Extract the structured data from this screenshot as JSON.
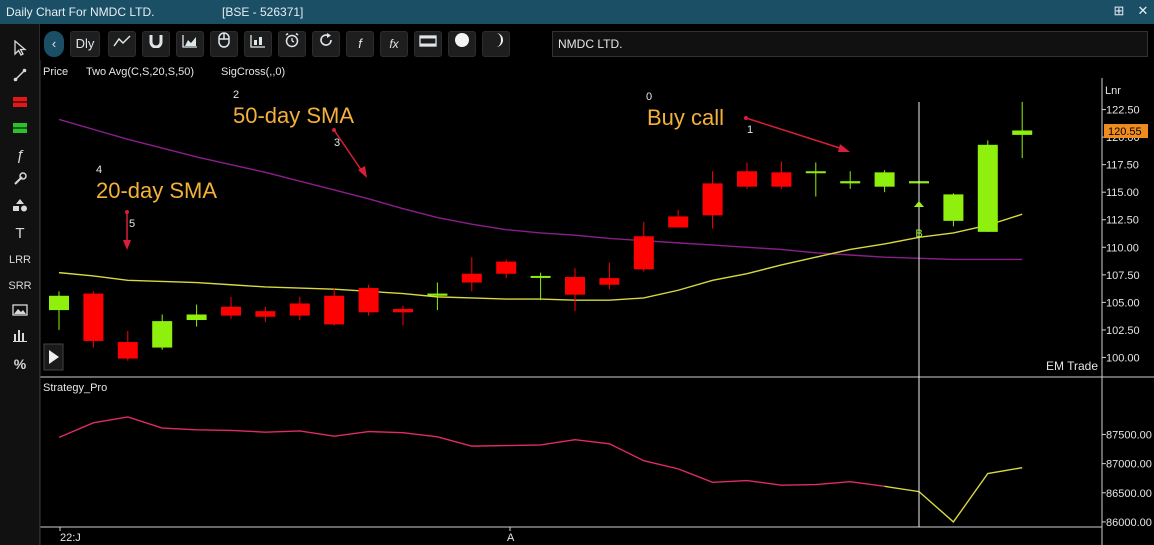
{
  "window": {
    "title": "Daily Chart For NMDC LTD.",
    "exchange": "[BSE - 526371]",
    "pin_icon": "pin-icon",
    "close_icon": "close-icon"
  },
  "toolbar": {
    "period": "Dly",
    "symbol_value": "NMDC LTD.",
    "fx_label": "fx",
    "f_label": "f",
    "buttons": [
      "back-icon",
      "line-icon",
      "magnet-icon",
      "area-icon",
      "mouse-icon",
      "bars-icon",
      "alarm-icon",
      "refresh-icon",
      "f-icon",
      "fx-icon",
      "film-icon",
      "circle-icon",
      "moon-icon"
    ]
  },
  "sidebar": {
    "items": [
      {
        "icon": "cursor-icon",
        "label": ""
      },
      {
        "icon": "trendline-icon",
        "label": ""
      },
      {
        "icon": "red-block-icon",
        "label": ""
      },
      {
        "icon": "green-block-icon",
        "label": ""
      },
      {
        "icon": "function-icon",
        "label": "ƒ"
      },
      {
        "icon": "wrench-icon",
        "label": ""
      },
      {
        "icon": "shapes-icon",
        "label": ""
      },
      {
        "icon": "text-icon",
        "label": "T"
      },
      {
        "icon": "lrr-icon",
        "label": "LRR"
      },
      {
        "icon": "srr-icon",
        "label": "SRR"
      },
      {
        "icon": "image-icon",
        "label": ""
      },
      {
        "icon": "bar-chart-icon",
        "label": ""
      },
      {
        "icon": "percent-icon",
        "label": "%"
      }
    ]
  },
  "colors": {
    "up": "#8ff00d",
    "down": "#ff0000",
    "sma20": "#d8d840",
    "sma50": "#8a1f8a",
    "strategy": "#e02a6a",
    "annotation": "#f3b13a",
    "arrow": "#d81e3a",
    "price_tag": "#f08c1e"
  },
  "labels": {
    "price": "Price",
    "two_avg": "Two Avg(C,S,20,S,50)",
    "sigcross": "SigCross(,,0)",
    "scale": "Lnr",
    "brand": "EM Trade",
    "strategy": "Strategy_Pro",
    "date_start": "22:J",
    "date_mid": "A",
    "buy_marker": "B",
    "last_price": "120.55"
  },
  "annotations": [
    {
      "num": "0",
      "text": "Buy call"
    },
    {
      "num": "1",
      "text": ""
    },
    {
      "num": "2",
      "text": "50-day SMA"
    },
    {
      "num": "3",
      "text": ""
    },
    {
      "num": "4",
      "text": "20-day SMA"
    },
    {
      "num": "5",
      "text": ""
    }
  ],
  "chart_data": {
    "type": "candlestick",
    "yaxis_price": {
      "ticks": [
        "122.50",
        "120.00",
        "117.50",
        "115.00",
        "112.50",
        "110.00",
        "107.50",
        "105.00",
        "102.50",
        "100.00"
      ],
      "range": [
        98.5,
        125.0
      ]
    },
    "yaxis_strategy": {
      "ticks": [
        "87500.00",
        "87000.00",
        "86500.00",
        "86000.00"
      ],
      "range": [
        85930,
        88400
      ]
    },
    "candles": [
      {
        "o": 104.3,
        "h": 106.0,
        "l": 102.5,
        "c": 105.6
      },
      {
        "o": 105.8,
        "h": 106.0,
        "l": 100.9,
        "c": 101.5
      },
      {
        "o": 101.4,
        "h": 102.4,
        "l": 99.7,
        "c": 99.9
      },
      {
        "o": 100.9,
        "h": 103.9,
        "l": 100.7,
        "c": 103.3
      },
      {
        "o": 103.4,
        "h": 104.8,
        "l": 102.8,
        "c": 103.9
      },
      {
        "o": 104.6,
        "h": 105.5,
        "l": 103.5,
        "c": 103.8
      },
      {
        "o": 104.2,
        "h": 104.6,
        "l": 103.2,
        "c": 103.7
      },
      {
        "o": 104.9,
        "h": 105.5,
        "l": 103.4,
        "c": 103.8
      },
      {
        "o": 105.6,
        "h": 106.3,
        "l": 102.9,
        "c": 103.0
      },
      {
        "o": 106.3,
        "h": 106.6,
        "l": 103.8,
        "c": 104.1
      },
      {
        "o": 104.4,
        "h": 104.7,
        "l": 102.9,
        "c": 104.1
      },
      {
        "o": 105.6,
        "h": 106.8,
        "l": 104.3,
        "c": 105.8
      },
      {
        "o": 107.6,
        "h": 109.1,
        "l": 106.0,
        "c": 106.8
      },
      {
        "o": 108.7,
        "h": 108.9,
        "l": 107.2,
        "c": 107.6
      },
      {
        "o": 107.4,
        "h": 107.7,
        "l": 105.2,
        "c": 107.4
      },
      {
        "o": 107.3,
        "h": 108.1,
        "l": 104.2,
        "c": 105.7
      },
      {
        "o": 107.2,
        "h": 108.6,
        "l": 106.2,
        "c": 106.6
      },
      {
        "o": 111.0,
        "h": 112.3,
        "l": 107.8,
        "c": 108.0
      },
      {
        "o": 112.8,
        "h": 113.4,
        "l": 111.8,
        "c": 111.8
      },
      {
        "o": 115.8,
        "h": 116.9,
        "l": 111.7,
        "c": 112.9
      },
      {
        "o": 116.9,
        "h": 117.7,
        "l": 115.3,
        "c": 115.5
      },
      {
        "o": 116.8,
        "h": 117.8,
        "l": 115.3,
        "c": 115.5
      },
      {
        "o": 116.9,
        "h": 117.7,
        "l": 114.6,
        "c": 116.9
      },
      {
        "o": 115.8,
        "h": 116.9,
        "l": 115.3,
        "c": 116.0
      },
      {
        "o": 115.5,
        "h": 117.0,
        "l": 115.0,
        "c": 116.8
      },
      {
        "o": 115.8,
        "h": 117.3,
        "l": 115.3,
        "c": 116.0
      },
      {
        "o": 112.4,
        "h": 114.9,
        "l": 111.9,
        "c": 114.8
      },
      {
        "o": 111.4,
        "h": 119.7,
        "l": 111.4,
        "c": 119.3
      },
      {
        "o": 120.2,
        "h": 123.2,
        "l": 118.1,
        "c": 120.6
      }
    ],
    "sma20": [
      107.7,
      107.4,
      107.0,
      106.9,
      106.8,
      106.6,
      106.4,
      106.3,
      106.2,
      106.0,
      105.8,
      105.5,
      105.4,
      105.3,
      105.3,
      105.2,
      105.2,
      105.4,
      106.1,
      107.0,
      107.6,
      108.4,
      109.1,
      109.8,
      110.3,
      110.9,
      111.3,
      112.0,
      113.0
    ],
    "sma50": [
      121.6,
      120.7,
      119.8,
      119.0,
      118.2,
      117.5,
      116.8,
      116.0,
      115.2,
      114.4,
      113.5,
      112.7,
      112.1,
      111.6,
      111.3,
      111.1,
      110.8,
      110.6,
      110.4,
      110.2,
      110.0,
      109.8,
      109.5,
      109.3,
      109.1,
      109.0,
      108.9,
      108.9,
      108.9
    ],
    "strategy_pro": [
      87450,
      87700,
      87800,
      87610,
      87580,
      87570,
      87540,
      87560,
      87470,
      87550,
      87530,
      87460,
      87300,
      87310,
      87320,
      87410,
      87340,
      87050,
      86910,
      86680,
      86710,
      86630,
      86640,
      86690,
      86610,
      86520,
      86000,
      86830,
      86930
    ],
    "buy_signal_index": 24
  }
}
